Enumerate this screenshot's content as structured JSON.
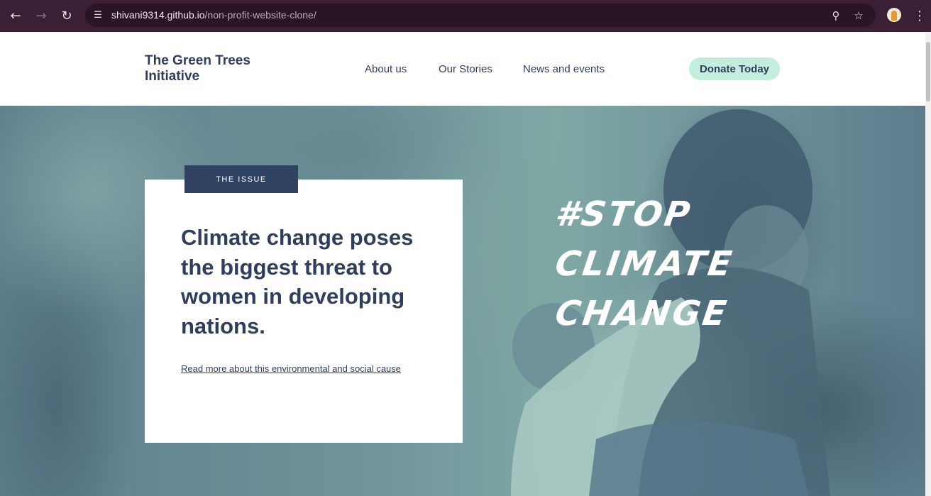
{
  "browser": {
    "url_host": "shivani9314.github.io",
    "url_path": "/non-profit-website-clone/"
  },
  "site": {
    "logo": "The Green Trees Initiative",
    "nav": [
      "About us",
      "Our Stories",
      "News and events"
    ],
    "donate_label": "Donate Today"
  },
  "hero": {
    "tag": "THE ISSUE",
    "headline": "Climate change poses the biggest threat to women in developing nations.",
    "link": "Read more about this environmental and social cause",
    "slogan_lines": [
      "#STOP",
      "CLIMATE",
      "CHANGE"
    ]
  },
  "colors": {
    "navy": "#2e3e5c",
    "mint": "#c3eedd",
    "tag_bg": "#2f4262",
    "chrome": "#3a1f35"
  }
}
